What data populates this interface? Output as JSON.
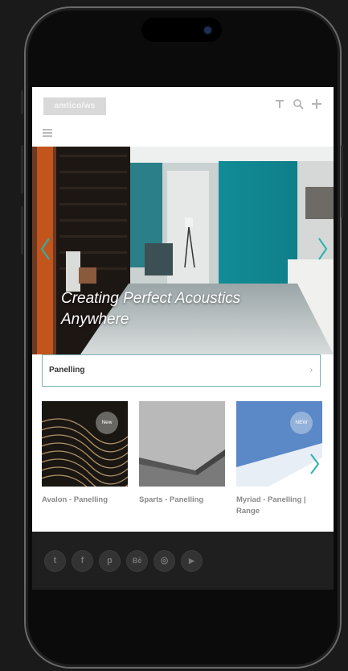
{
  "header": {
    "logo_text": "amtico/ws",
    "icons": [
      "filter-icon",
      "search-icon",
      "plus-icon"
    ]
  },
  "hero": {
    "caption_line1": "Creating Perfect Acoustics",
    "caption_line2": "Anywhere"
  },
  "filter": {
    "selected": "Panelling"
  },
  "products": [
    {
      "title": "Avalon - Panelling",
      "badge": "New"
    },
    {
      "title": "Sparts - Panelling",
      "badge": ""
    },
    {
      "title": "Myriad - Panelling |",
      "title_line2": "Range",
      "badge": "NEW"
    }
  ],
  "footer": {
    "social": [
      {
        "name": "twitter-icon",
        "glyph": "t"
      },
      {
        "name": "facebook-icon",
        "glyph": "f"
      },
      {
        "name": "pinterest-icon",
        "glyph": "p"
      },
      {
        "name": "behance-icon",
        "glyph": "Bē"
      },
      {
        "name": "instagram-icon",
        "glyph": "◎"
      },
      {
        "name": "youtube-icon",
        "glyph": "▶"
      }
    ]
  },
  "colors": {
    "accent": "#2bb1b0",
    "filter_border": "#7ab4b3",
    "footer_bg": "#1f1f1f"
  }
}
